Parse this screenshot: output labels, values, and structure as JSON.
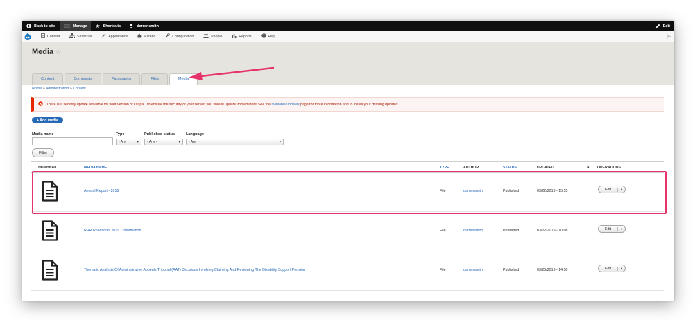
{
  "toolbar": {
    "back_to_site": "Back to site",
    "manage": "Manage",
    "shortcuts": "Shortcuts",
    "user": "darrensmith",
    "edit": "Edit"
  },
  "tray": {
    "items": [
      "Content",
      "Structure",
      "Appearance",
      "Extend",
      "Configuration",
      "People",
      "Reports",
      "Help"
    ]
  },
  "page": {
    "title": "Media",
    "tabs": [
      "Content",
      "Comments",
      "Paragraphs",
      "Files",
      "Media"
    ],
    "active_tab": "Media"
  },
  "breadcrumb": [
    "Home",
    "Administration",
    "Content"
  ],
  "message": {
    "text_before": "There is a security update available for your version of Drupal. To ensure the security of your server, you should update immediately! See the",
    "link": "available updates",
    "text_after": "page for more information and to install your missing updates."
  },
  "add_media_label": "+ Add media",
  "filters": {
    "media_name_label": "Media name",
    "media_name_value": "",
    "type_label": "Type",
    "type_value": "- Any -",
    "status_label": "Published status",
    "status_value": "- Any -",
    "language_label": "Language",
    "language_value": "- Any -",
    "filter_button": "Filter"
  },
  "table": {
    "headers": {
      "thumbnail": "THUMBNAIL",
      "media_name": "MEDIA NAME",
      "type": "TYPE",
      "author": "AUTHOR",
      "status": "STATUS",
      "updated": "UPDATED",
      "operations": "OPERATIONS"
    },
    "rows": [
      {
        "name": "Annual Report - 2018",
        "type": "File",
        "author": "darrensmith",
        "status": "Published",
        "updated": "03/22/2019 - 15:55",
        "op": "Edit"
      },
      {
        "name": "RRR Roadshow 2019 - Information",
        "type": "File",
        "author": "darrensmith",
        "status": "Published",
        "updated": "03/22/2019 - 10:08",
        "op": "Edit"
      },
      {
        "name": "Thematic Analysis Of Administrative Appeals Tribunal (AAT) Decisions Involving Claiming And Reviewing The Disability Support Pension",
        "type": "File",
        "author": "darrensmith",
        "status": "Published",
        "updated": "03/20/2019 - 14:50",
        "op": "Edit"
      }
    ]
  },
  "colors": {
    "accent_link": "#2869b6",
    "error": "#e62600",
    "highlight": "#e6346b"
  }
}
